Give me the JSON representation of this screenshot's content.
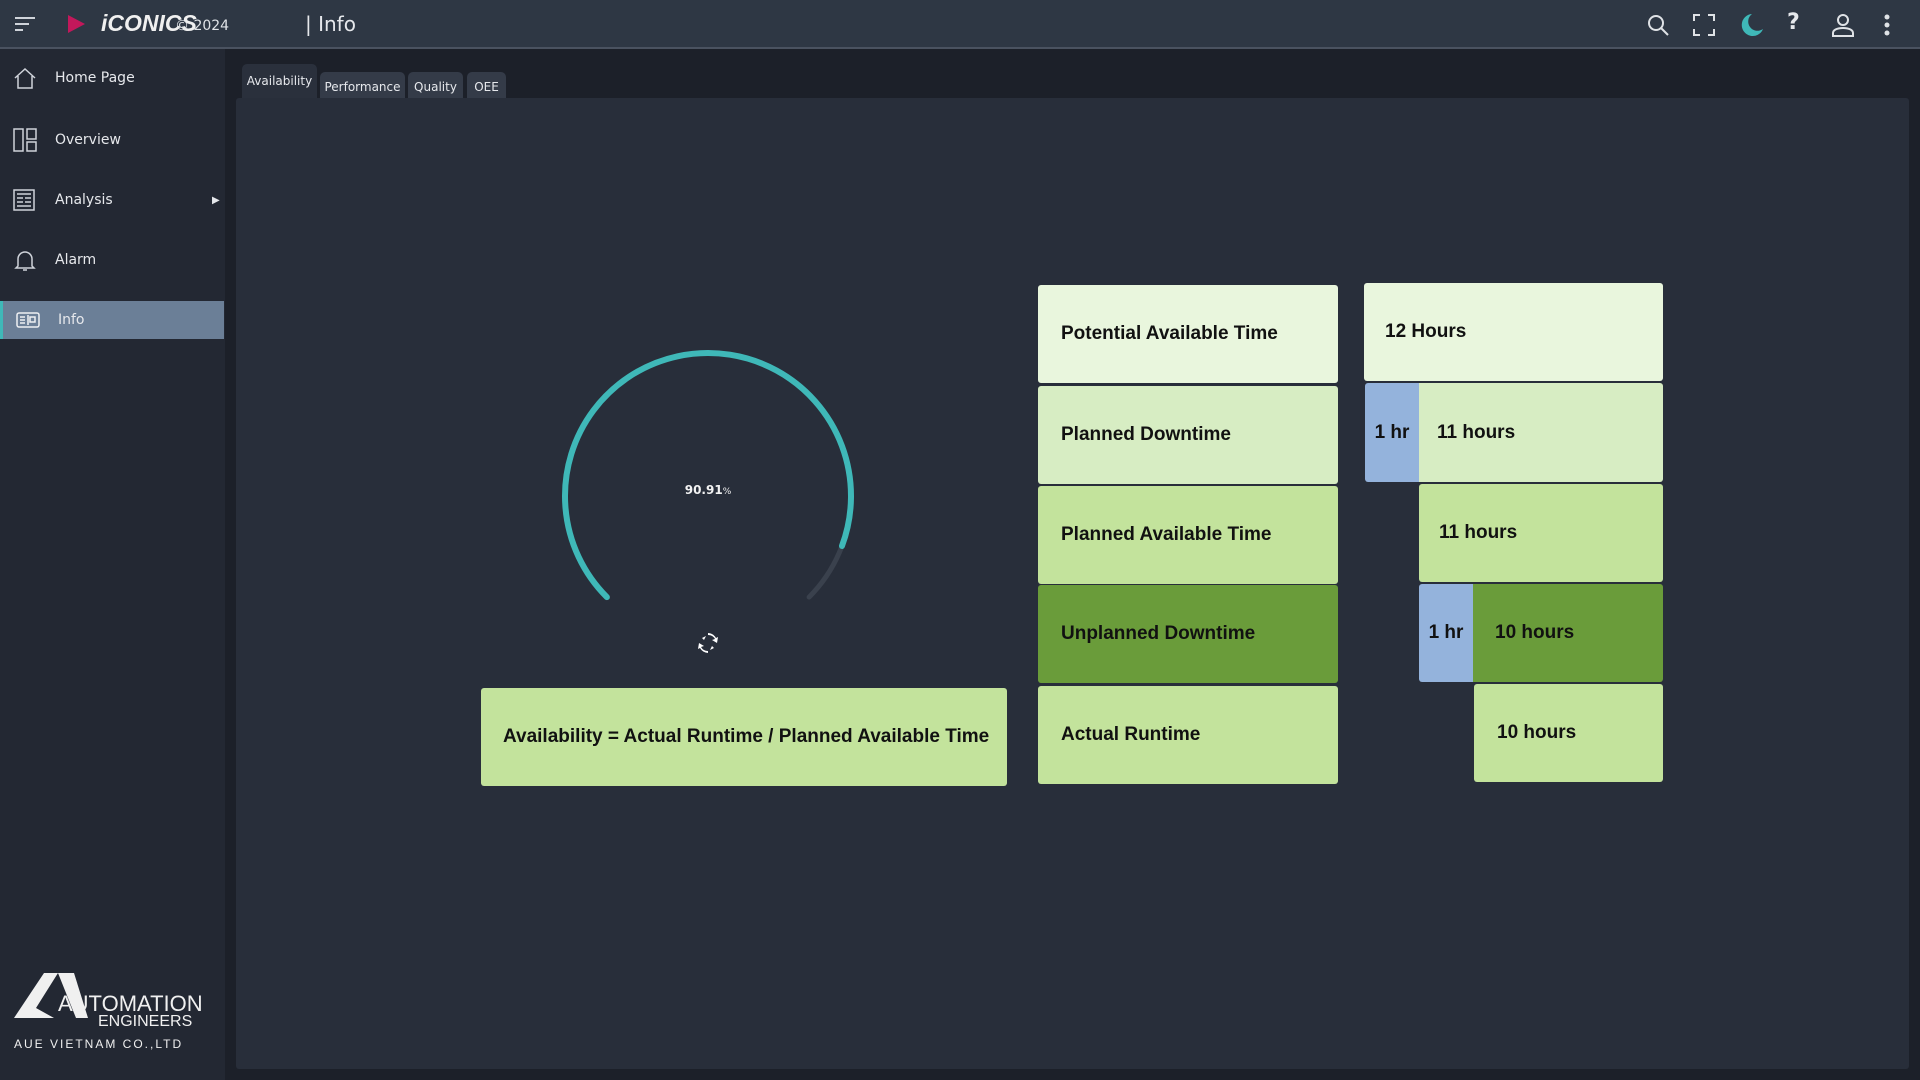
{
  "header": {
    "brand": "iCONICS",
    "copyright": "© 2024",
    "title": "| Info",
    "icons": [
      "menu-icon",
      "play-logo-icon",
      "search-icon",
      "fullscreen-icon",
      "dark-mode-moon-icon",
      "help-icon",
      "user-icon",
      "more-vert-icon"
    ],
    "accent": "#3fb8b8",
    "brand_color": "#c2185b"
  },
  "sidebar": {
    "items": [
      {
        "label": "Home Page",
        "icon": "home-icon"
      },
      {
        "label": "Overview",
        "icon": "dashboard-icon"
      },
      {
        "label": "Analysis",
        "icon": "analysis-icon",
        "has_submenu": true
      },
      {
        "label": "Alarm",
        "icon": "bell-icon"
      },
      {
        "label": "Info",
        "icon": "info-card-icon",
        "active": true
      }
    ],
    "logo": {
      "line1": "AUTOMATION",
      "line2": "ENGINEERS",
      "line3": "AUE VIETNAM CO.,LTD"
    }
  },
  "tabs": [
    {
      "label": "Availability",
      "active": true
    },
    {
      "label": "Performance"
    },
    {
      "label": "Quality"
    },
    {
      "label": "OEE"
    }
  ],
  "gauge": {
    "value": 90.91,
    "value_text": "90.91",
    "unit": "%",
    "color": "#3fb8b8",
    "track_color": "#3a414d"
  },
  "formula": "Availability = Actual Runtime / Planned Available Time",
  "labels": [
    "Potential Available Time",
    "Planned Downtime",
    "Planned Available Time",
    "Unplanned Downtime",
    "Actual Runtime"
  ],
  "values": {
    "potential": "12 Hours",
    "planned_downtime": "1 hr",
    "after_planned": "11 hours",
    "planned_available": "11 hours",
    "unplanned_downtime": "1 hr",
    "after_unplanned": "10 hours",
    "actual_runtime": "10 hours"
  }
}
